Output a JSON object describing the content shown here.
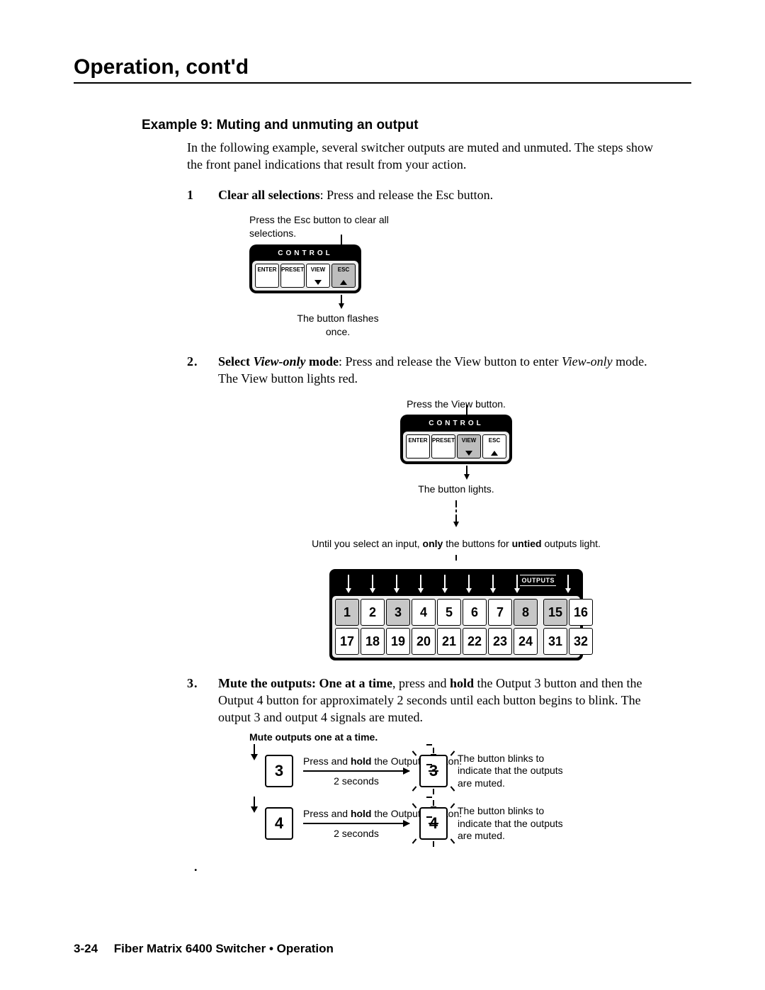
{
  "chapter_title": "Operation, cont'd",
  "example_title": "Example 9: Muting and unmuting an output",
  "intro": "In the following example, several switcher outputs are muted and unmuted.  The steps show the front panel indications that result from your action.",
  "steps": {
    "s1": {
      "lead": "Clear all selections",
      "rest": ": Press and release the Esc button.",
      "fig_top": "Press the Esc button to clear all selections.",
      "fig_bottom": "The button flashes once."
    },
    "s2": {
      "lead1": "Select ",
      "lead2_bi": "View-only",
      "lead3_b": " mode",
      "rest1": ": Press and release the View button to enter ",
      "rest2_i": "View-only",
      "rest3": " mode.  The View button lights red.",
      "fig_top": "Press the View button.",
      "fig_mid": "The button lights.",
      "note_pre": "Until you select an input, ",
      "note_b1": "only",
      "note_mid": " the buttons for ",
      "note_b2": "untied",
      "note_post": " outputs light."
    },
    "s3": {
      "lead": "Mute the outputs",
      "lead2_b": ": One at a time",
      "rest1": ", press and ",
      "rest_hold": "hold",
      "rest2": " the Output 3 button and then the Output 4 button for approximately 2 seconds until each button begins to blink.  The output 3 and output 4 signals are muted.",
      "mute_heading": "Mute outputs one at a time.",
      "m3_top_a": "Press and ",
      "m_hold": "hold",
      "m3_top_b": " the Output 3 button.",
      "m4_top_b": " the Output 4 button.",
      "seconds": "2 seconds",
      "blink_note": "The button blinks to indicate that the outputs are muted."
    }
  },
  "control": {
    "label": "CONTROL",
    "enter": "ENTER",
    "preset": "PRESET",
    "view": "VIEW",
    "esc": "ESC"
  },
  "outputs": {
    "label": "OUTPUTS",
    "row1": [
      "1",
      "2",
      "3",
      "4",
      "5",
      "6",
      "7",
      "8",
      "15",
      "16"
    ],
    "row2": [
      "17",
      "18",
      "19",
      "20",
      "21",
      "22",
      "23",
      "24",
      "31",
      "32"
    ]
  },
  "btn3": "3",
  "btn4": "4",
  "footer": {
    "page": "3-24",
    "title": "Fiber Matrix 6400 Switcher • Operation"
  }
}
